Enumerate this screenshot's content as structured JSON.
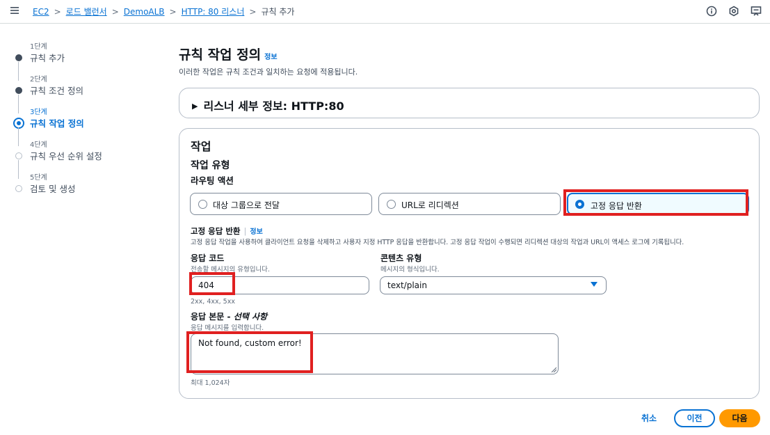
{
  "breadcrumbs": [
    {
      "label": "EC2"
    },
    {
      "label": "로드 밸런서"
    },
    {
      "label": "DemoALB"
    },
    {
      "label": "HTTP: 80 리스너"
    },
    {
      "label": "규칙 추가"
    }
  ],
  "top_icons": [
    "info-icon",
    "settings-icon",
    "feedback-icon"
  ],
  "steps": [
    {
      "num": "1단계",
      "title": "규칙 추가",
      "state": "done"
    },
    {
      "num": "2단계",
      "title": "규칙 조건 정의",
      "state": "done"
    },
    {
      "num": "3단계",
      "title": "규칙 작업 정의",
      "state": "current"
    },
    {
      "num": "4단계",
      "title": "규칙 우선 순위 설정",
      "state": "pending"
    },
    {
      "num": "5단계",
      "title": "검토 및 생성",
      "state": "pending"
    }
  ],
  "page": {
    "title": "규칙 작업 정의",
    "info": "정보",
    "description": "이러한 작업은 규칙 조건과 일치하는 요청에 적용됩니다."
  },
  "listener_panel": {
    "title": "리스너 세부 정보: HTTP:80"
  },
  "action_panel": {
    "heading": "작업",
    "type_heading": "작업 유형",
    "routing_label": "라우팅 액션",
    "options": [
      {
        "label": "대상 그룹으로 전달",
        "selected": false
      },
      {
        "label": "URL로 리디렉션",
        "selected": false
      },
      {
        "label": "고정 응답 반환",
        "selected": true
      }
    ],
    "fixed_response": {
      "heading": "고정 응답 반환",
      "info": "정보",
      "description": "고정 응답 작업을 사용하여 클라이언트 요청을 삭제하고 사용자 지정 HTTP 응답을 반환합니다. 고정 응답 작업이 수행되면 리디렉션 대상의 작업과 URL이 액세스 로그에 기록됩니다."
    },
    "response_code": {
      "label": "응답 코드",
      "description": "전송할 메시지의 유형입니다.",
      "value": "404",
      "hint": "2xx, 4xx, 5xx"
    },
    "content_type": {
      "label": "콘텐츠 유형",
      "description": "메시지의 형식입니다.",
      "value": "text/plain"
    },
    "response_body": {
      "label": "응답 본문 - ",
      "label_optional": "선택 사항",
      "description": "응답 메시지를 입력합니다.",
      "value": "Not found, custom error!",
      "hint": "최대 1,024자"
    }
  },
  "footer": {
    "cancel": "취소",
    "previous": "이전",
    "next": "다음"
  },
  "colors": {
    "accent": "#0972d3",
    "primary_button": "#ff9900",
    "highlight": "#e02020"
  }
}
